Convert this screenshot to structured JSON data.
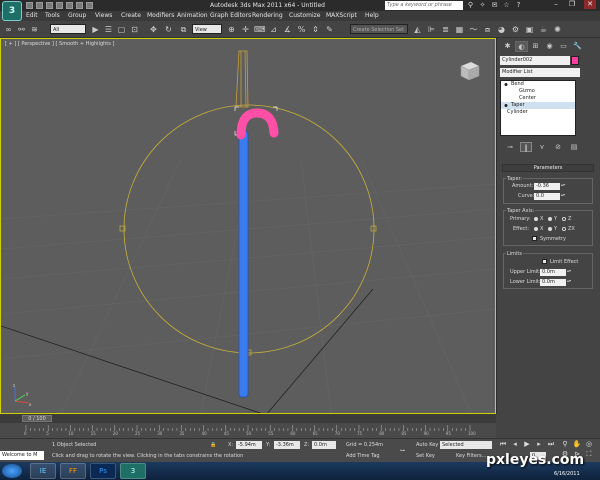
{
  "app": {
    "title": "Autodesk 3ds Max 2011 x64 - Untitled",
    "search_placeholder": "Type a keyword or phrase",
    "logo_letter": "3"
  },
  "menu": [
    "Edit",
    "Tools",
    "Group",
    "Views",
    "Create",
    "Modifiers",
    "Animation",
    "Graph Editors",
    "Rendering",
    "Customize",
    "MAXScript",
    "Help"
  ],
  "toolbar": {
    "selection_filter": "All",
    "ref_coord": "View",
    "named_selection": "Create Selection Set"
  },
  "viewport": {
    "label": "[ + ] [ Perspective ] [ Smooth + Highlights ]",
    "axis_x": "x",
    "axis_y": "y",
    "axis_z": "z"
  },
  "command_panel": {
    "object_name": "Cylinder002",
    "object_color": "#ff3fa0",
    "modifier_list": "Modifier List",
    "stack": [
      {
        "label": "Bend",
        "level": 0,
        "bulb": true
      },
      {
        "label": "Gizmo",
        "level": 1,
        "bulb": false
      },
      {
        "label": "Center",
        "level": 1,
        "bulb": false
      },
      {
        "label": "Taper",
        "level": 0,
        "bulb": true,
        "selected": true
      },
      {
        "label": "Cylinder",
        "level": 0,
        "bulb": false
      }
    ],
    "parameters_title": "Parameters",
    "taper_group": "Taper:",
    "amount_label": "Amount:",
    "amount_value": "-0.36",
    "curve_label": "Curve:",
    "curve_value": "0.0",
    "taper_axis_group": "Taper Axis:",
    "primary_label": "Primary:",
    "effect_label": "Effect:",
    "axis_x": "X",
    "axis_y": "Y",
    "axis_z": "Z",
    "axis_zx": "ZX",
    "symmetry_label": "Symmetry",
    "limits_group": "Limits",
    "limit_effect_label": "Limit Effect",
    "upper_label": "Upper Limit:",
    "upper_value": "0.0m",
    "lower_label": "Lower Limit:",
    "lower_value": "0.0m"
  },
  "timeline": {
    "frame_display": "0 / 100",
    "ticks": [
      "0",
      "5",
      "10",
      "15",
      "20",
      "25",
      "30",
      "35",
      "40",
      "45",
      "50",
      "55",
      "60",
      "65",
      "70",
      "75",
      "80",
      "85",
      "90",
      "95",
      "100"
    ]
  },
  "status": {
    "selection": "1 Object Selected",
    "prompt": "Click and drag to rotate the view. Clicking in the tabs constrains the rotation",
    "x_label": "X:",
    "x_value": "-5.94m",
    "y_label": "Y:",
    "y_value": "-3.36m",
    "z_label": "Z:",
    "z_value": "0.0m",
    "grid": "Grid = 0.254m",
    "add_time_tag": "Add Time Tag",
    "auto_key": "Auto Key",
    "key_mode": "Selected",
    "set_key": "Set Key",
    "key_filters": "Key Filters...",
    "frame": "0",
    "maxscript": "Welcome to M"
  },
  "taskbar": {
    "start": "",
    "apps": [
      "IE",
      "FF",
      "Ps",
      "3"
    ],
    "date": "6/16/2011"
  },
  "watermark": "pxleyes.com"
}
